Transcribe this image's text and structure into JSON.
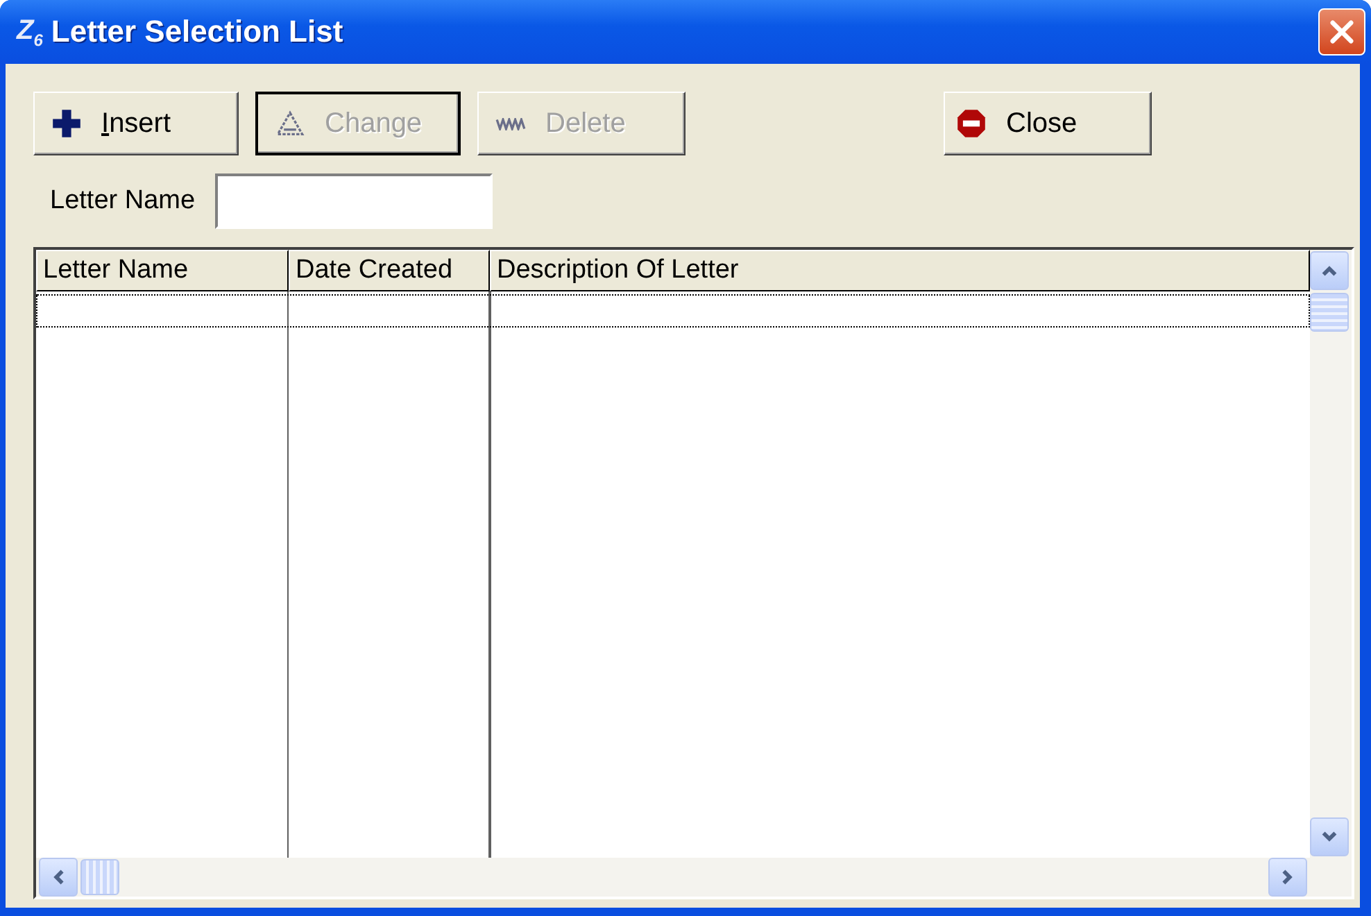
{
  "window": {
    "app_mark": "Z$_{6}$",
    "title": "Letter Selection List"
  },
  "toolbar": [
    {
      "kind": "insert",
      "label": "Insert",
      "access_key": true,
      "disabled": false,
      "focused": false
    },
    {
      "kind": "change",
      "label": "Change",
      "access_key": false,
      "disabled": true,
      "focused": true
    },
    {
      "kind": "delete",
      "label": "Delete",
      "access_key": false,
      "disabled": true,
      "focused": false
    },
    {
      "kind": "close",
      "label": "Close",
      "access_key": false,
      "disabled": false,
      "focused": false
    }
  ],
  "filter": {
    "label": "Letter Name"
  },
  "table": {
    "columns": [
      "Letter Name",
      "Date Created",
      "Description Of Letter"
    ],
    "rows": [
      {
        "focused": true
      }
    ]
  }
}
